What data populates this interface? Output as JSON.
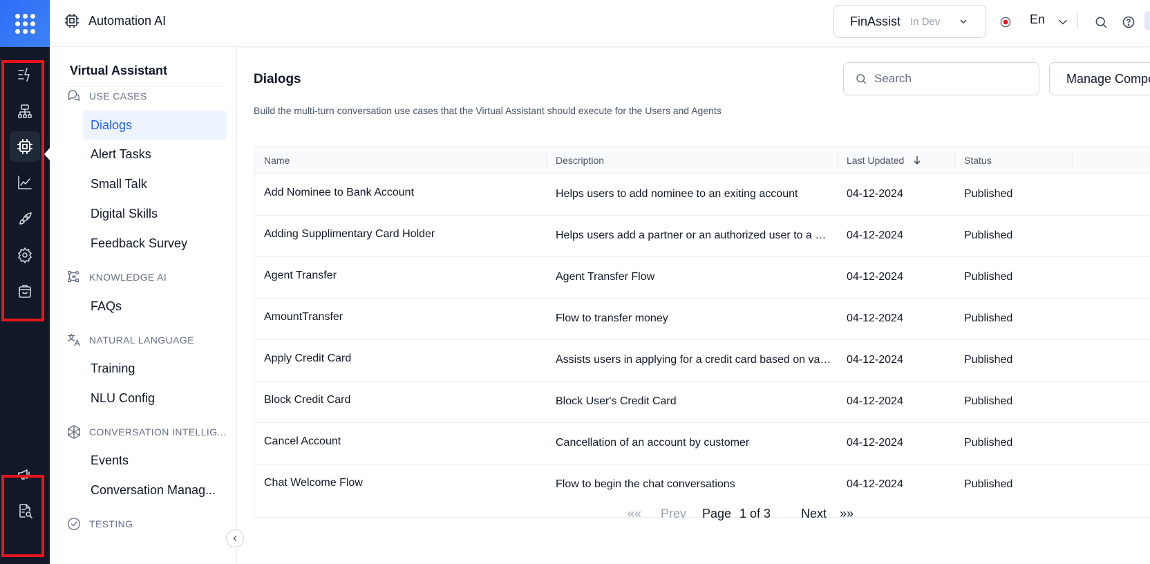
{
  "topbar": {
    "product": "Automation AI",
    "app_name": "FinAssist",
    "app_env": "In Dev",
    "language": "En"
  },
  "rail": {
    "top_icons": [
      "automation-icon",
      "flow-icon",
      "chip-icon",
      "analytics-icon",
      "rocket-icon",
      "settings-icon",
      "store-icon"
    ],
    "bottom_icons": [
      "megaphone-icon",
      "doc-search-icon"
    ],
    "active": "chip-icon",
    "highlight_color": "#e8141c"
  },
  "leftnav": {
    "title": "Virtual Assistant",
    "sections": [
      {
        "label": "USE CASES",
        "items": [
          "Dialogs",
          "Alert Tasks",
          "Small Talk",
          "Digital Skills",
          "Feedback Survey"
        ]
      },
      {
        "label": "KNOWLEDGE AI",
        "items": [
          "FAQs"
        ]
      },
      {
        "label": "NATURAL LANGUAGE",
        "items": [
          "Training",
          "NLU Config"
        ]
      },
      {
        "label": "CONVERSATION INTELLIG...",
        "items": [
          "Events",
          "Conversation Manag..."
        ]
      },
      {
        "label": "TESTING",
        "items": []
      }
    ],
    "active_item": "Dialogs"
  },
  "main": {
    "title": "Dialogs",
    "description": "Build the multi-turn conversation use cases that the Virtual Assistant should execute for the Users and Agents",
    "search_placeholder": "Search",
    "manage_button": "Manage Compo",
    "columns": [
      "Name",
      "Description",
      "Last Updated",
      "Status"
    ],
    "rows": [
      {
        "name": "Add Nominee to Bank Account",
        "description": "Helps users to add nominee to an exiting account",
        "updated": "04-12-2024",
        "status": "Published"
      },
      {
        "name": "Adding Supplimentary Card Holder",
        "description": "Helps users add a partner or an authorized user to a Cr...",
        "updated": "04-12-2024",
        "status": "Published"
      },
      {
        "name": "Agent Transfer",
        "description": "Agent Transfer Flow",
        "updated": "04-12-2024",
        "status": "Published"
      },
      {
        "name": "AmountTransfer",
        "description": "Flow to transfer money",
        "updated": "04-12-2024",
        "status": "Published"
      },
      {
        "name": "Apply Credit Card",
        "description": "Assists users in applying for a credit card based on vari...",
        "updated": "04-12-2024",
        "status": "Published"
      },
      {
        "name": "Block Credit Card",
        "description": "Block User's Credit Card",
        "updated": "04-12-2024",
        "status": "Published"
      },
      {
        "name": "Cancel Account",
        "description": "Cancellation of an account by customer",
        "updated": "04-12-2024",
        "status": "Published"
      },
      {
        "name": "Chat Welcome Flow",
        "description": "Flow to begin the chat conversations",
        "updated": "04-12-2024",
        "status": "Published"
      }
    ],
    "pagination": {
      "first": "««",
      "prev": "Prev",
      "page_label": "Page",
      "page_value": "1 of 3",
      "next": "Next",
      "last": "»»"
    }
  }
}
